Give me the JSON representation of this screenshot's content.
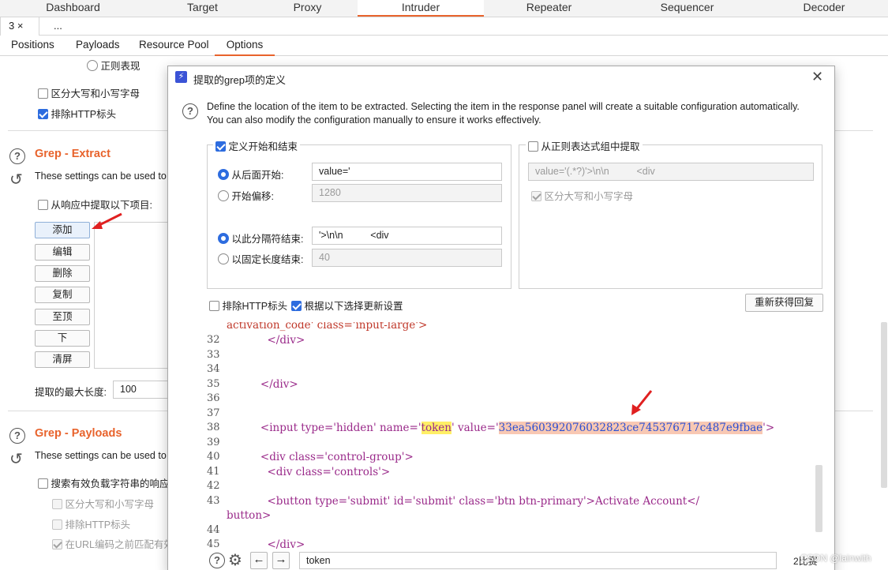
{
  "top_tabs": [
    "Dashboard",
    "Target",
    "Proxy",
    "Intruder",
    "Repeater",
    "Sequencer",
    "Decoder"
  ],
  "sub_tabs": [
    "3 ×",
    "..."
  ],
  "option_tabs": [
    "Positions",
    "Payloads",
    "Resource Pool",
    "Options"
  ],
  "bg": {
    "regex_radio": "正则表现",
    "case_sensitive": "区分大写和小写字母",
    "exclude_http": "排除HTTP标头",
    "grep_extract_title": "Grep - Extract",
    "grep_extract_desc": "These settings can be used to",
    "extract_checkbox": "从响应中提取以下项目:",
    "buttons": [
      "添加",
      "编辑",
      "删除",
      "复制",
      "至顶",
      "下",
      "清屏"
    ],
    "max_len_label": "提取的最大长度:",
    "max_len_value": "100",
    "grep_payloads_title": "Grep - Payloads",
    "grep_payloads_desc": "These settings can be used to",
    "search_payload": "搜索有效负载字符串的响应",
    "gp_case": "区分大写和小写字母",
    "gp_exclude": "排除HTTP标头",
    "gp_url": "在URL编码之前匹配有效"
  },
  "dialog": {
    "title": "提取的grep项的定义",
    "desc1": "Define the location of the item to be extracted. Selecting the item in the response panel will create a suitable configuration automatically.",
    "desc2": "You can also modify the configuration manually to ensure it works effectively.",
    "left_legend": "定义开始和结束",
    "start_after_label": "从后面开始:",
    "start_after_value": "value='",
    "start_offset_label": "开始偏移:",
    "start_offset_value": "1280",
    "end_delim_label": "以此分隔符结束:",
    "end_delim_value": "'>\\n\\n          <div",
    "end_fixed_label": "以固定长度结束:",
    "end_fixed_value": "40",
    "right_legend": "从正则表达式组中提取",
    "regex_value": "value='(.*?)'>\\n\\n          <div",
    "regex_case": "区分大写和小写字母",
    "exclude_http": "排除HTTP标头",
    "update_config": "根据以下选择更新设置",
    "refetch_button": "重新获得回复",
    "search_value": "token",
    "match_count": "2比赛"
  },
  "code": {
    "first_line": "activation_code' class='input-large'>",
    "lines": [
      {
        "n": "32",
        "text": "            </div>"
      },
      {
        "n": "33",
        "text": ""
      },
      {
        "n": "34",
        "text": ""
      },
      {
        "n": "35",
        "text": "          </div>"
      },
      {
        "n": "36",
        "text": ""
      },
      {
        "n": "37",
        "text": ""
      },
      {
        "n": "38",
        "text": ""
      },
      {
        "n": "39",
        "text": ""
      },
      {
        "n": "40",
        "text": ""
      },
      {
        "n": "41",
        "text": ""
      },
      {
        "n": "42",
        "text": ""
      },
      {
        "n": "43",
        "text": ""
      },
      {
        "n": "44",
        "text": ""
      },
      {
        "n": "45",
        "text": "            </div>"
      }
    ],
    "l38": {
      "pre": "          <input type='hidden' name='",
      "token": "token",
      "mid": "' value='",
      "hash": "33ea560392076032823ce745376717c487e9fbae",
      "post": "'>"
    },
    "l40": "          <div class='control-group'>",
    "l41": "            <div class='controls'>",
    "l43": "            <button type='submit' id='submit' class='btn btn-primary'>Activate Account</",
    "l43b": "button>"
  },
  "watermark": "CSDN @lainwith",
  "colors": {
    "accent": "#e8632c",
    "blue": "#2d6cdf"
  }
}
